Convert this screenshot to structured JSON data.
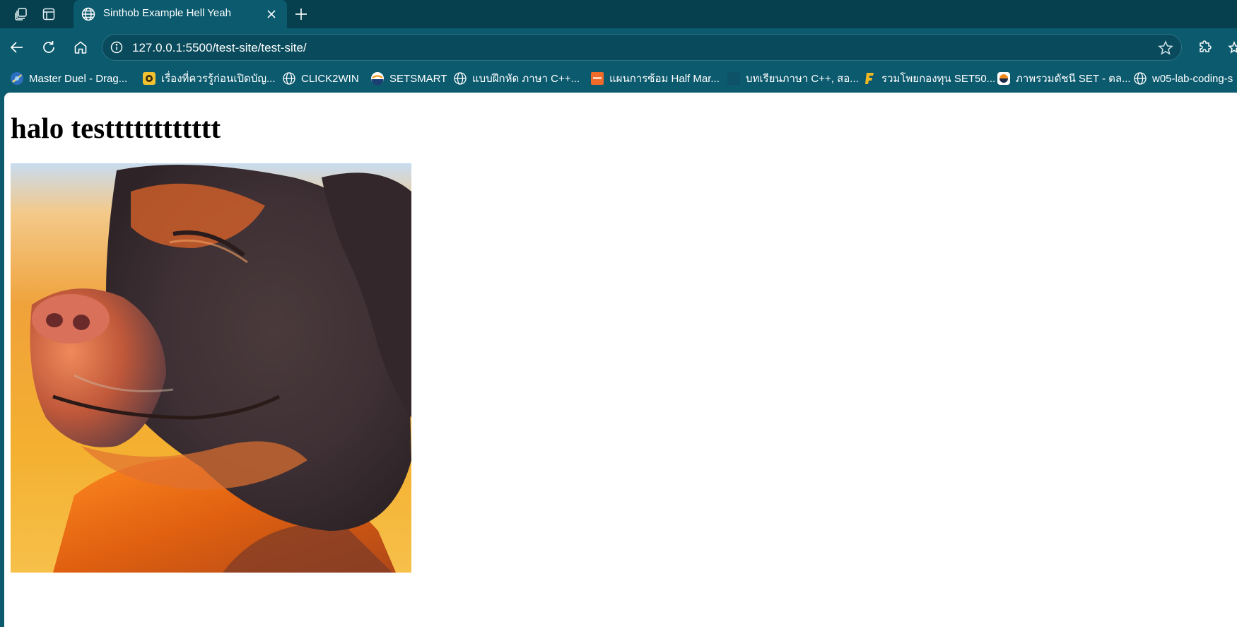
{
  "browser": {
    "tab": {
      "title": "Sinthob Example Hell Yeah",
      "icon": "globe-icon"
    },
    "address_bar": {
      "url": "127.0.0.1:5500/test-site/test-site/",
      "site_info_icon": "info-icon",
      "favorite_icon": "star-icon"
    },
    "toolbar_icons": [
      "back-icon",
      "refresh-icon",
      "home-icon",
      "extensions-icon"
    ],
    "bookmarks": [
      {
        "label": "Master Duel - Drag...",
        "icon": "master-duel-icon"
      },
      {
        "label": "เรื่องที่ควรรู้ก่อนเปิดบัญ...",
        "icon": "bank-logo-icon"
      },
      {
        "label": "CLICK2WIN",
        "icon": "globe-icon"
      },
      {
        "label": "SETSMART",
        "icon": "setsmart-icon"
      },
      {
        "label": "แบบฝึกหัด ภาษา C++...",
        "icon": "globe-icon"
      },
      {
        "label": "แผนการซ้อม Half Mar...",
        "icon": "orange-square-icon"
      },
      {
        "label": "บทเรียนภาษา C++, สอ...",
        "icon": "dark-square-icon"
      },
      {
        "label": "รวมโพยกองทุน SET50...",
        "icon": "f-logo-icon"
      },
      {
        "label": "ภาพรวมดัชนี SET - ตล...",
        "icon": "set-logo-icon"
      },
      {
        "label": "w05-lab-coding-s",
        "icon": "globe-icon"
      }
    ],
    "colors": {
      "tabstrip": "#06404f",
      "toolbar": "#0b5a6e",
      "page_background": "#ffffff"
    }
  },
  "page": {
    "heading": "halo testttttttttttt",
    "image": {
      "subject": "dog photo (gif)",
      "icon": "dog-image"
    }
  }
}
